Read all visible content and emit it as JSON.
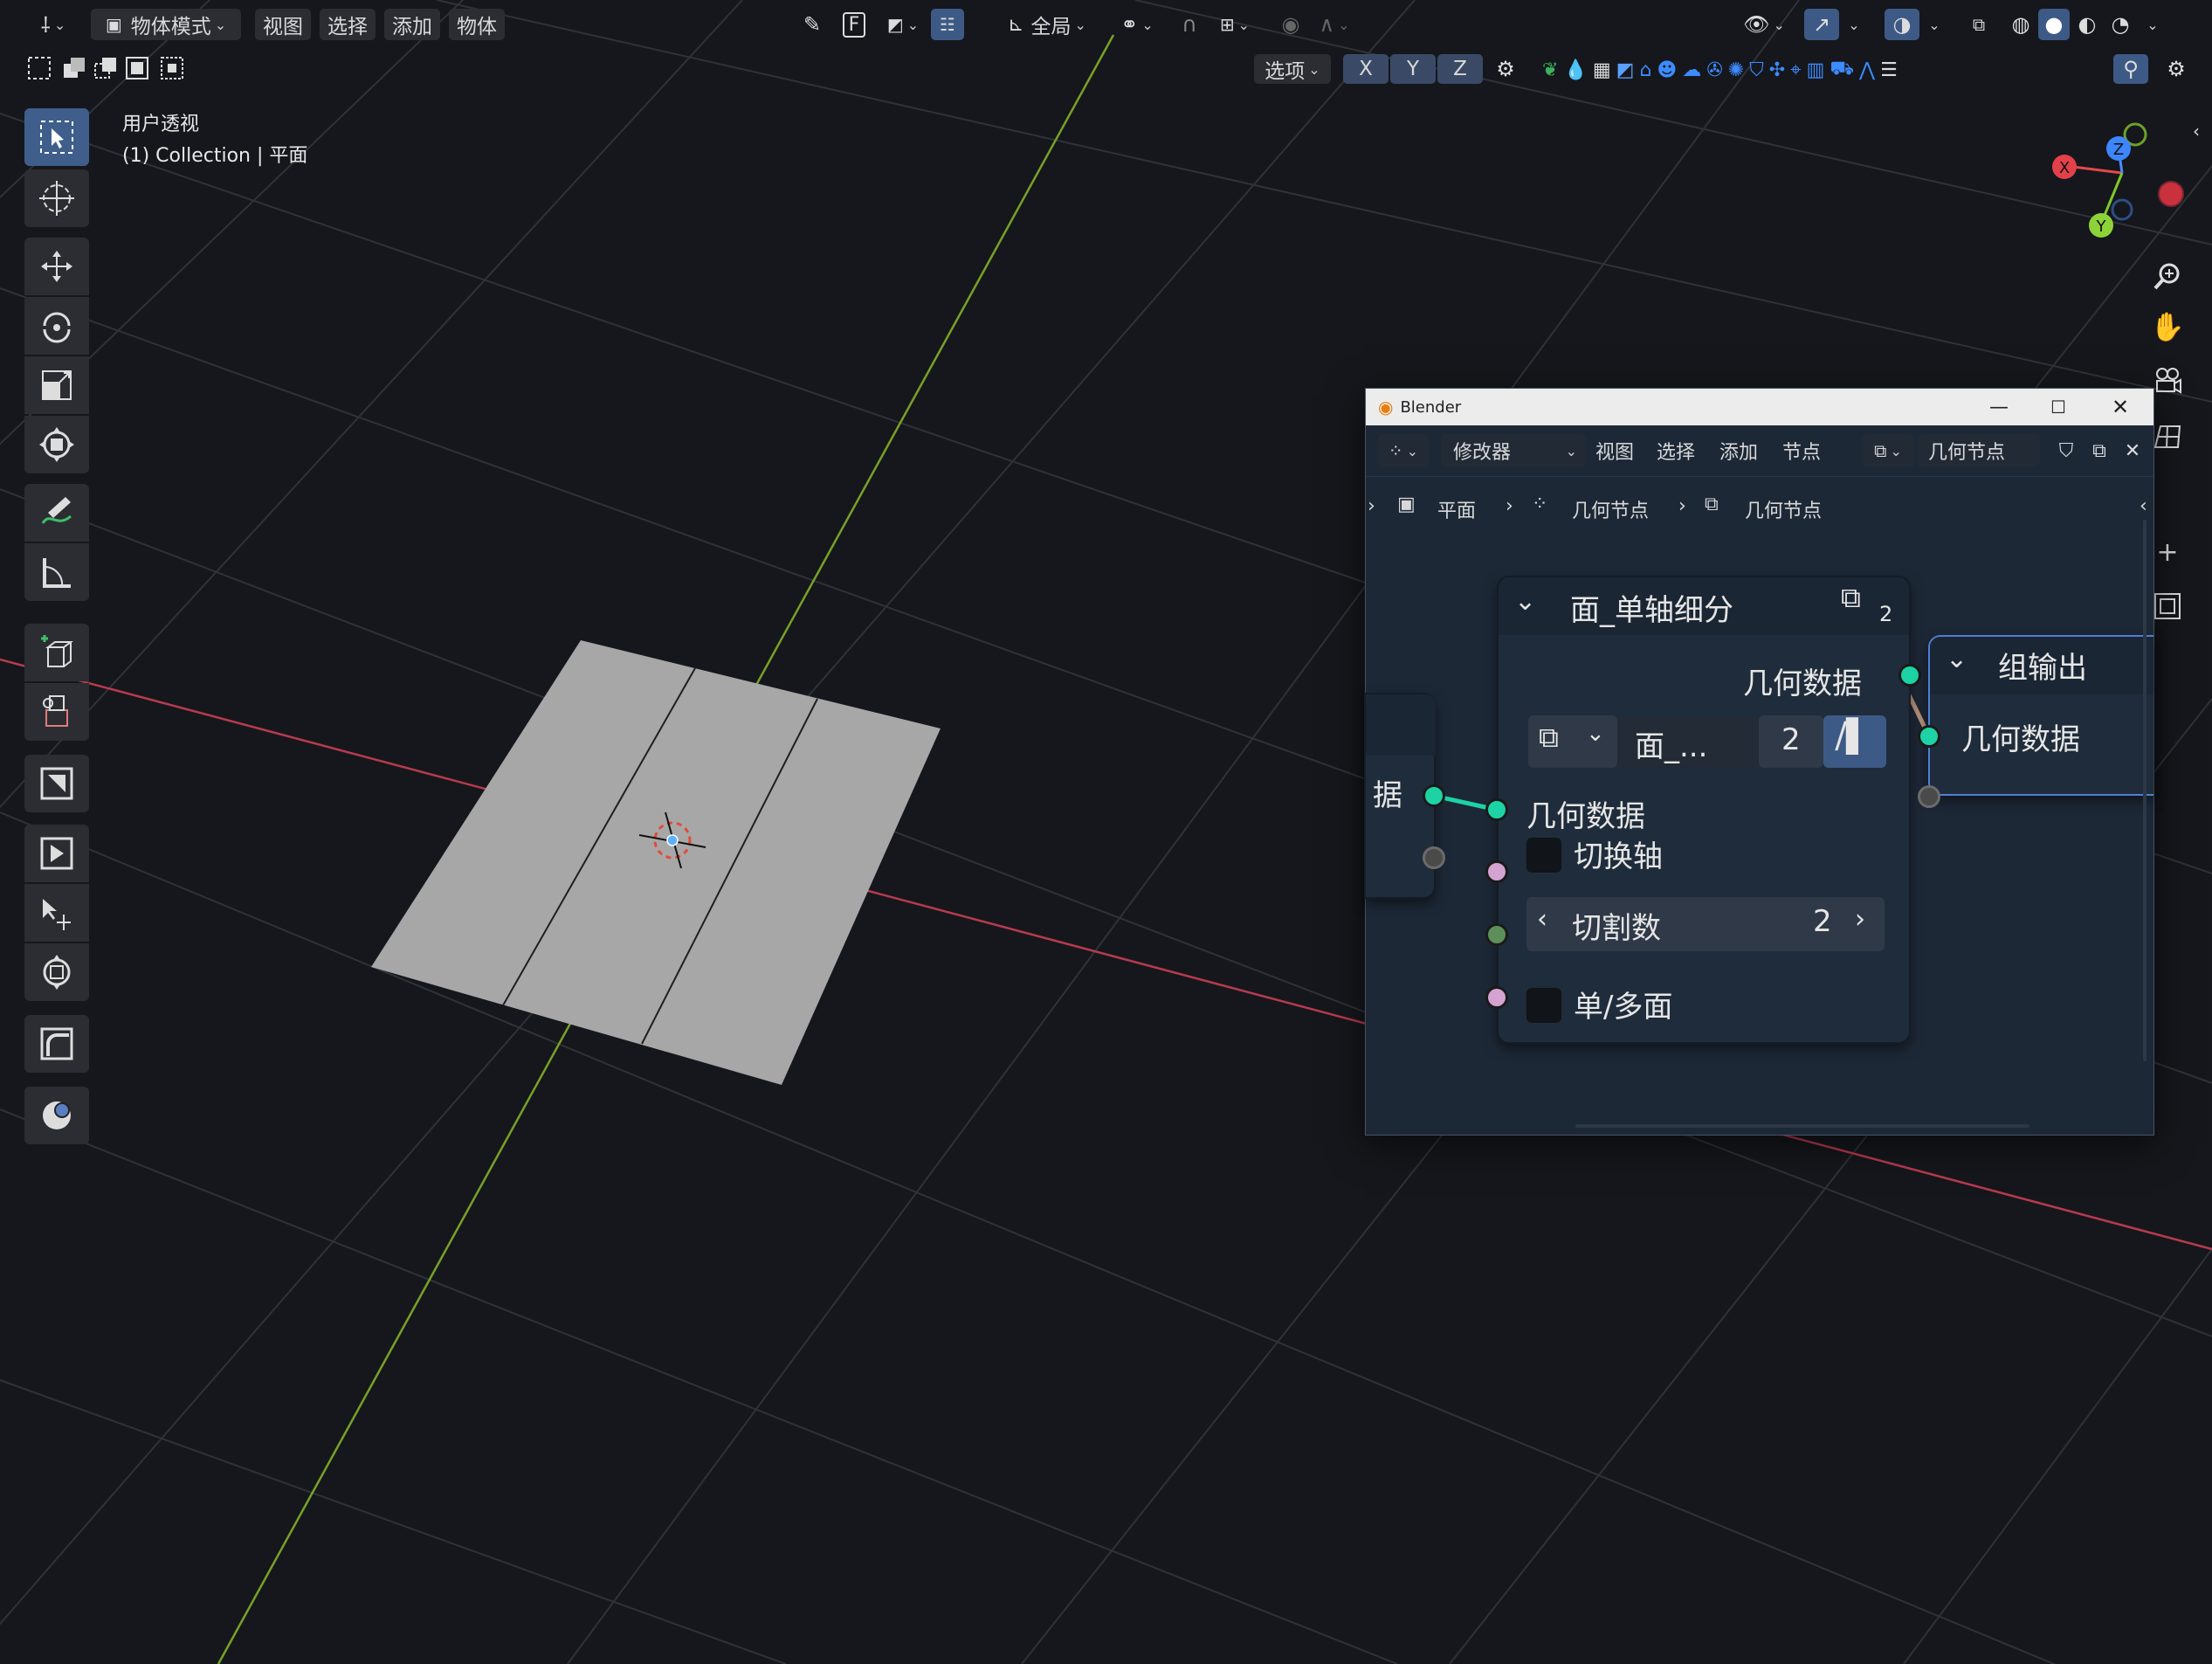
{
  "header": {
    "mode_label": "物体模式",
    "menus": [
      "视图",
      "选择",
      "添加",
      "物体"
    ],
    "transform_pivot": "全局",
    "options_label": "选项",
    "axes": [
      "X",
      "Y",
      "Z"
    ],
    "snap_letter": "F"
  },
  "viewport": {
    "view_name": "用户透视",
    "collection_label": "(1) Collection | 平面",
    "gizmo_axes": [
      "X",
      "Y",
      "Z"
    ]
  },
  "left_tools": [
    "select-box",
    "cursor",
    "move",
    "rotate",
    "scale",
    "transform",
    "annotate",
    "measure",
    "add-cube",
    "extrude",
    "inset",
    "bevel",
    "loop-cut",
    "spin",
    "shear",
    "shrink"
  ],
  "node_window": {
    "title": "Blender",
    "editor_menu": "修改器",
    "menus": [
      "视图",
      "选择",
      "添加",
      "节点"
    ],
    "tree_name": "几何节点",
    "breadcrumb": [
      "平面",
      "几何节点",
      "几何节点"
    ],
    "left_node_partial_text": "据",
    "group_node": {
      "title": "面_单轴细分",
      "user_count": "2",
      "output_label": "几何数据",
      "group_field_name": "面_...",
      "group_field_users": "2",
      "input_geometry": "几何数据",
      "switch_axis": "切换轴",
      "cuts_label": "切割数",
      "cuts_value": "2",
      "single_multi": "单/多面"
    },
    "output_node": {
      "title": "组输出",
      "input_label": "几何数据"
    }
  },
  "colors": {
    "background": "#15171c",
    "grid": "#2f3238",
    "x_axis": "#b83a4f",
    "y_axis": "#78a128",
    "plane": "#a7a7a7",
    "geometry_socket": "#1dd3a5",
    "bool_socket": "#d4a3d2",
    "int_socket": "#5d8f5a",
    "active_tool": "#3f5e8c"
  }
}
